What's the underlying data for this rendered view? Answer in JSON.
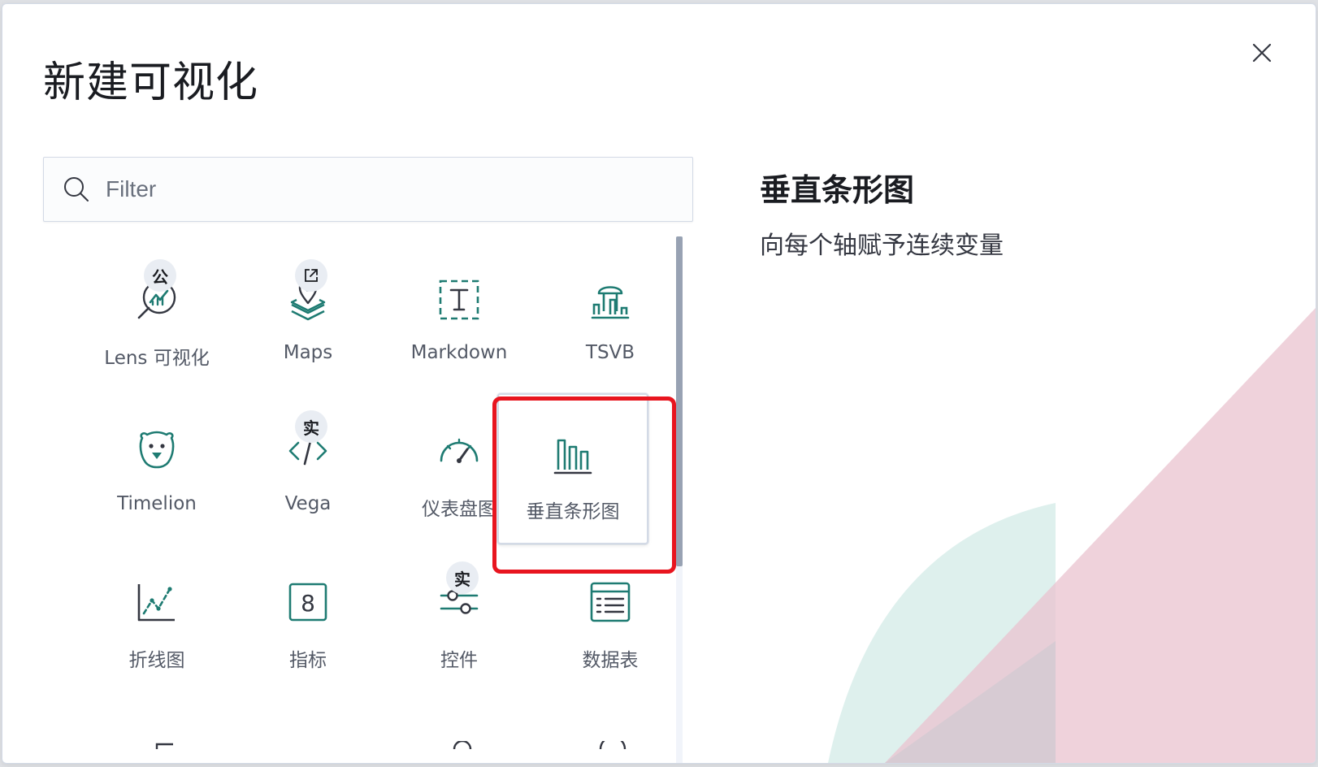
{
  "modal": {
    "title": "新建可视化",
    "close_label": "close"
  },
  "search": {
    "placeholder": "Filter",
    "value": ""
  },
  "colors": {
    "accent": "#1e7b72",
    "selection_outline": "#e8151f",
    "badge_bg": "#e9edf3"
  },
  "cards": [
    {
      "label": "Lens 可视化",
      "icon": "lens-icon",
      "badge": "公"
    },
    {
      "label": "Maps",
      "icon": "maps-icon",
      "badge_icon": "external-link-icon"
    },
    {
      "label": "Markdown",
      "icon": "markdown-icon"
    },
    {
      "label": "TSVB",
      "icon": "tsvb-icon"
    },
    {
      "label": "Timelion",
      "icon": "timelion-icon"
    },
    {
      "label": "Vega",
      "icon": "vega-code-icon",
      "badge": "实"
    },
    {
      "label": "仪表盘图",
      "icon": "gauge-icon"
    },
    {
      "label": "垂直条形图",
      "icon": "vertical-bar-icon",
      "selected": true
    },
    {
      "label": "折线图",
      "icon": "line-chart-icon"
    },
    {
      "label": "指标",
      "icon": "metric-icon"
    },
    {
      "label": "控件",
      "icon": "controls-icon",
      "badge": "实"
    },
    {
      "label": "数据表",
      "icon": "data-table-icon"
    }
  ],
  "description": {
    "title": "垂直条形图",
    "text": "向每个轴赋予连续变量"
  }
}
